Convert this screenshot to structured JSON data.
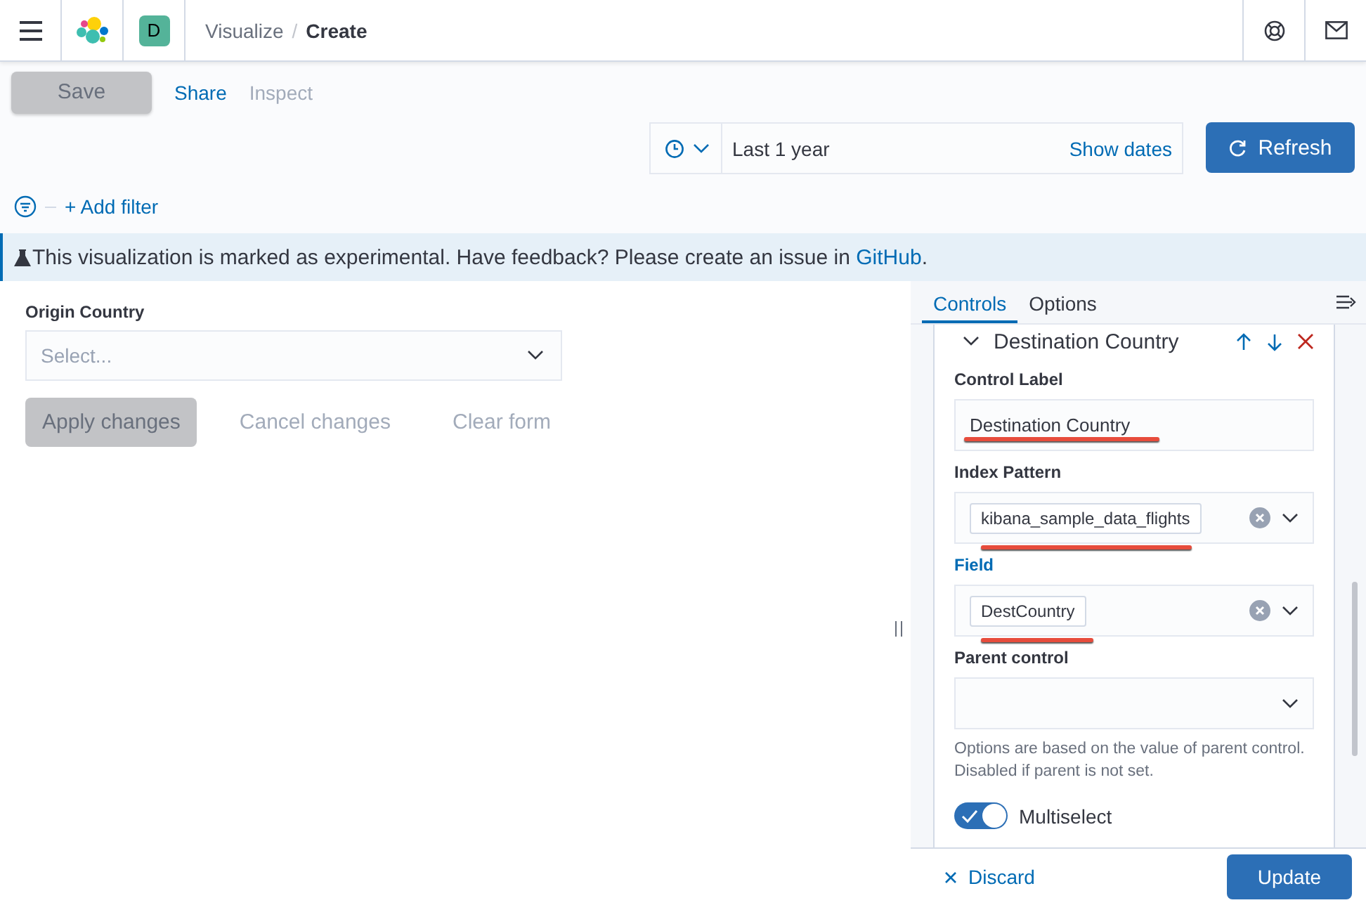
{
  "header": {
    "avatar": "D",
    "separator": "/",
    "breadcrumbs": [
      {
        "label": "Visualize",
        "selected": false
      },
      {
        "label": "Create",
        "selected": true
      }
    ]
  },
  "toolbar": {
    "save": {
      "label": "Save",
      "disabled": true
    },
    "links": [
      {
        "label": "Share",
        "disabled": false
      },
      {
        "label": "Inspect",
        "disabled": true
      }
    ]
  },
  "time_picker": {
    "value": "Last 1 year",
    "show_dates": "Show dates",
    "refresh": "Refresh"
  },
  "filter_bar": {
    "add_filter": "+ Add filter"
  },
  "callout": {
    "text": "This visualization is marked as experimental. Have feedback? Please create an issue in ",
    "link": "GitHub",
    "end": "."
  },
  "preview": {
    "control_label": "Origin Country",
    "placeholder": "Select...",
    "buttons": [
      {
        "label": "Apply changes",
        "kind": "filled"
      },
      {
        "label": "Cancel changes",
        "kind": "empty"
      },
      {
        "label": "Clear form",
        "kind": "empty"
      }
    ]
  },
  "editor": {
    "tabs": [
      {
        "label": "Controls",
        "selected": true
      },
      {
        "label": "Options",
        "selected": false
      }
    ],
    "control": {
      "title": "Destination Country",
      "expanded": true,
      "fields": [
        {
          "label": "Control Label",
          "kind": "text",
          "value": "Destination Country",
          "focused": false,
          "underlined": true
        },
        {
          "label": "Index Pattern",
          "kind": "combo",
          "value": "kibana_sample_data_flights",
          "focused": false,
          "underlined": true
        },
        {
          "label": "Field",
          "kind": "combo",
          "value": "DestCountry",
          "focused": true,
          "underlined": true
        },
        {
          "label": "Parent control",
          "kind": "select",
          "focused": false,
          "help": "Options are based on the value of parent control. Disabled if parent is not set."
        }
      ],
      "multiselect": {
        "label": "Multiselect",
        "on": true
      }
    },
    "discard": "Discard",
    "update": "Update"
  }
}
